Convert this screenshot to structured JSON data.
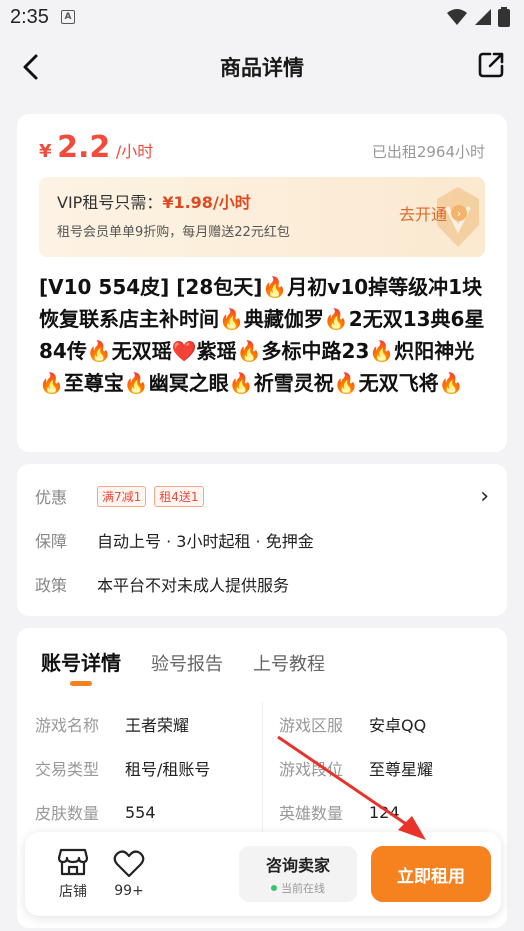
{
  "status_bar": {
    "time": "2:35",
    "a_badge": "A"
  },
  "header": {
    "title": "商品详情"
  },
  "price": {
    "symbol": "¥",
    "amount": "2.2",
    "unit": "/小时",
    "rented": "已出租2964小时"
  },
  "vip": {
    "line1_prefix": "VIP租号只需：",
    "line1_price": "¥1.98/小时",
    "line2": "租号会员单单9折购，每月赠送22元红包",
    "button": "去开通"
  },
  "product_title": "[V10 554皮] [28包天]🔥月初v10掉等级冲1块恢复联系店主补时间🔥典藏伽罗🔥2无双13典6星84传🔥无双瑶❤️紫瑶🔥多标中路23🔥炽阳神光🔥至尊宝🔥幽冥之眼🔥祈雪灵祝🔥无双飞将🔥",
  "info": {
    "discount_label": "优惠",
    "tags": [
      "满7减1",
      "租4送1"
    ],
    "guarantee_label": "保障",
    "guarantee_value": "自动上号 · 3小时起租 · 免押金",
    "policy_label": "政策",
    "policy_value": "本平台不对未成人提供服务"
  },
  "tabs": [
    "账号详情",
    "验号报告",
    "上号教程"
  ],
  "details_left": [
    {
      "label": "游戏名称",
      "value": "王者荣耀"
    },
    {
      "label": "交易类型",
      "value": "租号/租账号"
    },
    {
      "label": "皮肤数量",
      "value": "554"
    }
  ],
  "details_right": [
    {
      "label": "游戏区服",
      "value": "安卓QQ"
    },
    {
      "label": "游戏段位",
      "value": "至尊星耀"
    },
    {
      "label": "英雄数量",
      "value": "124"
    }
  ],
  "bottom": {
    "store_label": "店铺",
    "fav_count": "99+",
    "consult_title": "咨询卖家",
    "consult_status": "当前在线",
    "rent_button": "立即租用"
  },
  "colors": {
    "accent": "#f5821f",
    "price": "#f04b3c",
    "annotation": "#e8332a"
  }
}
